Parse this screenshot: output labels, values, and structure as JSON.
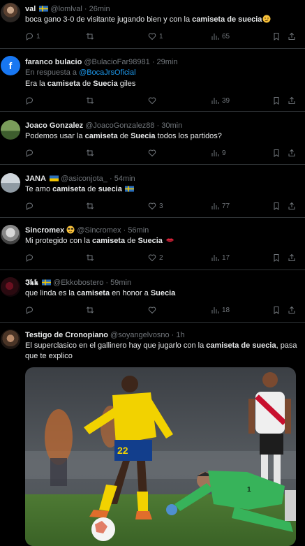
{
  "tweets": [
    {
      "name": "val",
      "flag": "sweden",
      "handle": "@lomlval",
      "sep": "·",
      "time": "26min",
      "text_parts": [
        "boca gano 3-0 de visitante jugando bien y con la ",
        "camiseta de suecia",
        ""
      ],
      "emoji": "smirk-face-emoji",
      "replies": "1",
      "retweets": "",
      "likes": "1",
      "views": "65"
    },
    {
      "name": "faranco bulacio",
      "handle": "@BulacioFar98981",
      "sep": "·",
      "time": "29min",
      "reply_prefix": "En respuesta a ",
      "reply_mention": "@BocaJrsOficial",
      "text_parts": [
        "Era la ",
        "camiseta",
        " de ",
        "Suecia",
        " giles"
      ],
      "replies": "",
      "retweets": "",
      "likes": "",
      "views": "39"
    },
    {
      "name": "Joaco Gonzalez",
      "handle": "@JoacoGonzalez88",
      "sep": "·",
      "time": "30min",
      "text_parts": [
        "Podemos usar la ",
        "camiseta",
        " de ",
        "Suecia",
        " todos los partidos?"
      ],
      "replies": "",
      "retweets": "",
      "likes": "",
      "views": "9"
    },
    {
      "name": "JANA",
      "flag": "ukraine",
      "handle": "@asiconjota_",
      "sep": "·",
      "time": "54min",
      "text_parts": [
        "Te amo ",
        "camiseta",
        " de ",
        "suecia",
        ""
      ],
      "replies": "",
      "retweets": "",
      "likes": "3",
      "views": "77"
    },
    {
      "name": "Sincromex",
      "handle": "@Sincromex",
      "sep": "·",
      "time": "56min",
      "text_parts": [
        "Mi protegido con la ",
        "camiseta",
        " de ",
        "Suecia",
        ""
      ],
      "replies": "",
      "retweets": "",
      "likes": "2",
      "views": "17"
    },
    {
      "name": "𝕴𝖐𝖐",
      "flag": "sweden",
      "handle": "@Ekkobostero",
      "sep": "·",
      "time": "59min",
      "text_parts": [
        "que linda es la ",
        "camiseta",
        " en honor a ",
        "Suecia",
        ""
      ],
      "replies": "",
      "retweets": "",
      "likes": "",
      "views": "18"
    },
    {
      "name": "Testigo de Cronopiano",
      "handle": "@soyangelvosno",
      "sep": "·",
      "time": "1h",
      "text_parts": [
        "El superclasico en el gallinero hay que jugarlo con la ",
        "camiseta de suecia",
        ", pasa que te explico"
      ],
      "media": "football-match-photo"
    }
  ],
  "colors": {
    "accent": "#1d9bf0",
    "muted": "#71767b",
    "text": "#e7e9ea",
    "border": "#2f3336"
  }
}
